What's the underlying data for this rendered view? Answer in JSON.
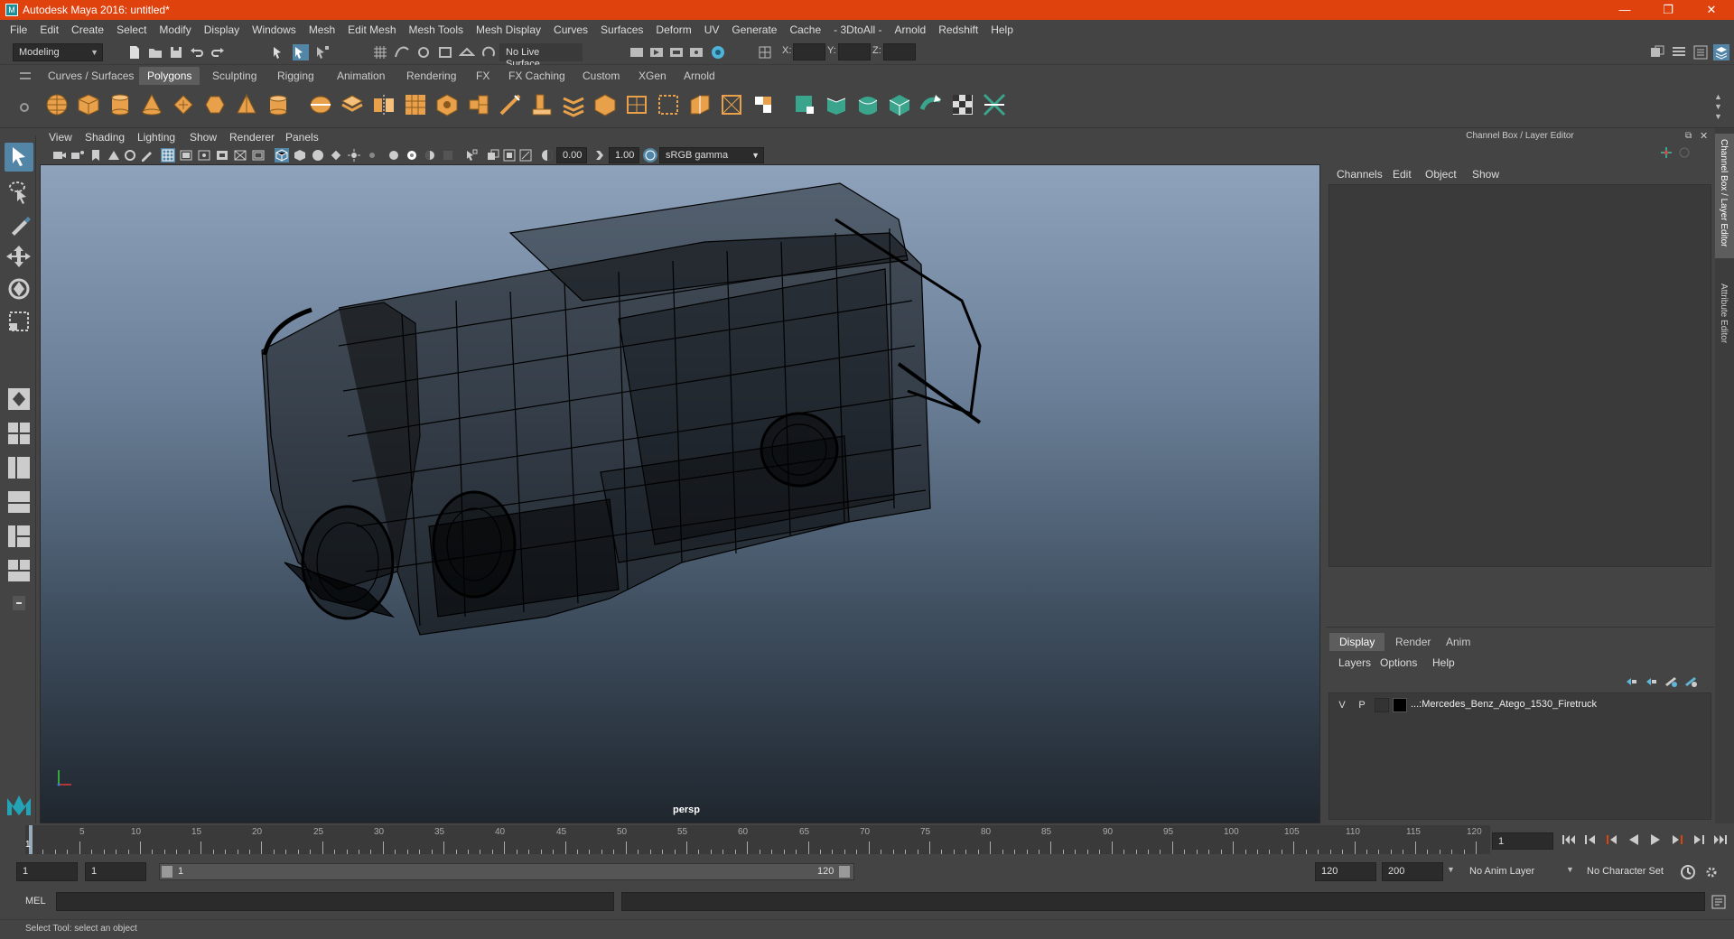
{
  "window": {
    "title": "Autodesk Maya 2016: untitled*",
    "app_icon": "maya-icon",
    "minimize": "—",
    "restore": "❐",
    "close": "✕"
  },
  "menubar": [
    "File",
    "Edit",
    "Create",
    "Select",
    "Modify",
    "Display",
    "Windows",
    "Mesh",
    "Edit Mesh",
    "Mesh Tools",
    "Mesh Display",
    "Curves",
    "Surfaces",
    "Deform",
    "UV",
    "Generate",
    "Cache",
    "- 3DtoAll -",
    "Arnold",
    "Redshift",
    "Help"
  ],
  "status_line": {
    "menu_set": "Modeling",
    "live_surface": "No Live Surface",
    "x_label": "X:",
    "y_label": "Y:",
    "z_label": "Z:"
  },
  "shelf_tabs": [
    "Curves / Surfaces",
    "Polygons",
    "Sculpting",
    "Rigging",
    "Animation",
    "Rendering",
    "FX",
    "FX Caching",
    "Custom",
    "XGen",
    "Arnold"
  ],
  "shelf_active": "Polygons",
  "viewport": {
    "menu": [
      "View",
      "Shading",
      "Lighting",
      "Show",
      "Renderer",
      "Panels"
    ],
    "exposure": "0.00",
    "gamma": "1.00",
    "color_space": "sRGB gamma",
    "camera_label": "persp",
    "axis_x": "x",
    "axis_y": "y"
  },
  "channel_box": {
    "title": "Channel Box / Layer Editor",
    "menu": [
      "Channels",
      "Edit",
      "Object",
      "Show"
    ]
  },
  "layer_editor": {
    "tabs": [
      "Display",
      "Render",
      "Anim"
    ],
    "active_tab": "Display",
    "menu": [
      "Layers",
      "Options",
      "Help"
    ],
    "layers": [
      {
        "visible": "V",
        "playback": "P",
        "name": "...:Mercedes_Benz_Atego_1530_Firetruck"
      }
    ]
  },
  "side_tabs": [
    "Channel Box / Layer Editor",
    "Attribute Editor"
  ],
  "time_slider": {
    "ticks": [
      "5",
      "10",
      "15",
      "20",
      "25",
      "30",
      "35",
      "40",
      "45",
      "50",
      "55",
      "60",
      "65",
      "70",
      "75",
      "80",
      "85",
      "90",
      "95",
      "100",
      "105",
      "110",
      "115",
      "120"
    ],
    "start_marker": "1",
    "current_frame": "1"
  },
  "range_slider": {
    "start_time": "1",
    "playback_start": "1",
    "range_start_label": "1",
    "range_end_label": "120",
    "playback_end": "120",
    "end_time": "200",
    "anim_layer": "No Anim Layer",
    "character_set": "No Character Set"
  },
  "command_line": {
    "label": "MEL"
  },
  "help_line": {
    "text": "Select Tool: select an object"
  },
  "colors": {
    "titlebar": "#e0420e",
    "active_tool": "#5285a6",
    "shelf_orange": "#e8a04a",
    "shelf_green": "#3aa58c"
  }
}
